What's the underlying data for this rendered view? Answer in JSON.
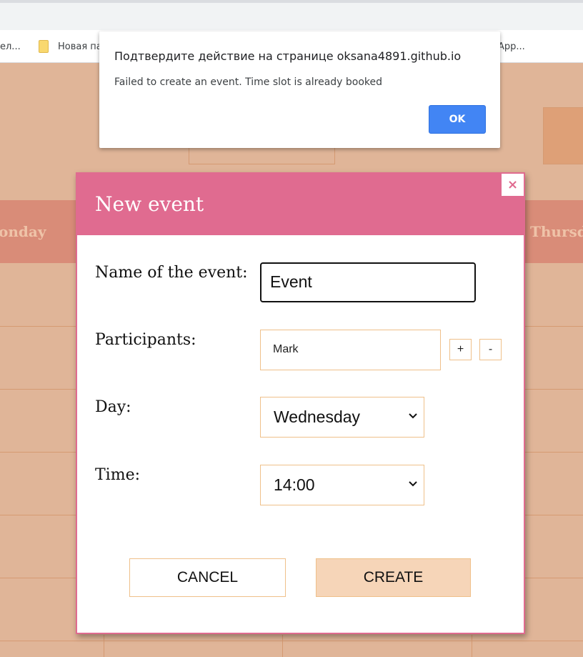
{
  "browser": {
    "bookmarks": {
      "left_partial": "ел...",
      "folder_label": "Новая па",
      "right_partial": "App..."
    }
  },
  "alert": {
    "title": "Подтвердите действие на странице oksana4891.github.io",
    "message": "Failed to create an event. Time slot is already booked",
    "ok_label": "OK"
  },
  "calendar": {
    "days": [
      "onday",
      "Thursda"
    ]
  },
  "modal": {
    "title": "New event",
    "close_label": "×",
    "fields": {
      "name_label": "Name of the event:",
      "name_value": "Event",
      "participants_label": "Participants:",
      "participants_value": "Mark",
      "add_label": "+",
      "remove_label": "-",
      "day_label": "Day:",
      "day_value": "Wednesday",
      "time_label": "Time:",
      "time_value": "14:00"
    },
    "cancel_label": "CANCEL",
    "create_label": "CREATE"
  },
  "colors": {
    "accent": "#e06b90",
    "background": "#e0b598",
    "ok_button": "#4285f4",
    "create_button": "#f6d5b8"
  }
}
